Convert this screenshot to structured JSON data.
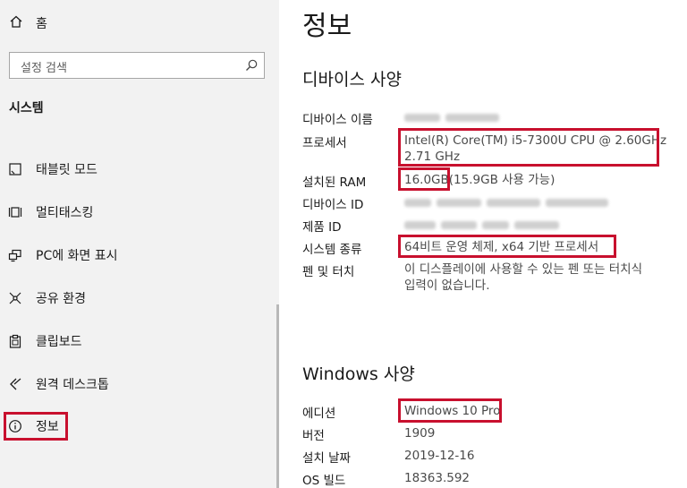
{
  "sidebar": {
    "home_label": "홈",
    "search_placeholder": "설정 검색",
    "section_title": "시스템",
    "items": [
      {
        "label": "태블릿 모드",
        "icon": "tablet-mode-icon"
      },
      {
        "label": "멀티태스킹",
        "icon": "multitasking-icon"
      },
      {
        "label": "PC에 화면 표시",
        "icon": "project-to-pc-icon"
      },
      {
        "label": "공유 환경",
        "icon": "shared-experiences-icon"
      },
      {
        "label": "클립보드",
        "icon": "clipboard-icon"
      },
      {
        "label": "원격 데스크톱",
        "icon": "remote-desktop-icon"
      },
      {
        "label": "정보",
        "icon": "info-icon",
        "selected": true
      }
    ]
  },
  "main": {
    "title": "정보",
    "device_specs": {
      "heading": "디바이스 사양",
      "rows": [
        {
          "label": "디바이스 이름",
          "value": "",
          "redacted": true
        },
        {
          "label": "프로세서",
          "value_line1": "Intel(R) Core(TM) i5-7300U CPU @ 2.60GHz",
          "value_line2": "2.71 GHz"
        },
        {
          "label": "설치된 RAM",
          "value": "16.0GB(15.9GB 사용 가능)"
        },
        {
          "label": "디바이스 ID",
          "value": "",
          "redacted": true
        },
        {
          "label": "제품 ID",
          "value": "",
          "redacted": true
        },
        {
          "label": "시스템 종류",
          "value": "64비트 운영 체제, x64 기반 프로세서"
        },
        {
          "label": "펜 및 터치",
          "value_line1": "이 디스플레이에 사용할 수 있는 펜 또는 터치식",
          "value_line2": "입력이 없습니다."
        }
      ]
    },
    "windows_specs": {
      "heading": "Windows 사양",
      "rows": [
        {
          "label": "에디션",
          "value": "Windows 10 Pro"
        },
        {
          "label": "버전",
          "value": "1909"
        },
        {
          "label": "설치 날짜",
          "value": "2019-12-16"
        },
        {
          "label": "OS 빌드",
          "value": "18363.592"
        }
      ]
    }
  },
  "colors": {
    "highlight": "#c8102e",
    "sidebar_bg": "#f2f2f2"
  }
}
